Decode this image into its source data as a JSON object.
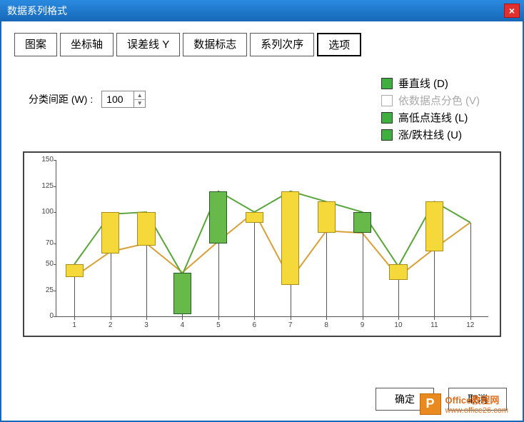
{
  "window": {
    "title": "数据系列格式",
    "close_label": "×"
  },
  "tabs": [
    {
      "label": "图案"
    },
    {
      "label": "坐标轴"
    },
    {
      "label": "误差线 Y"
    },
    {
      "label": "数据标志"
    },
    {
      "label": "系列次序"
    },
    {
      "label": "选项",
      "active": true
    }
  ],
  "gap": {
    "label": "分类间距 (W) :",
    "value": "100"
  },
  "legend_options": [
    {
      "label": "垂直线 (D)",
      "swatch": "green",
      "enabled": true
    },
    {
      "label": "依数据点分色 (V)",
      "swatch": "empty",
      "enabled": false
    },
    {
      "label": "高低点连线 (L)",
      "swatch": "green",
      "enabled": true
    },
    {
      "label": "涨/跌柱线 (U)",
      "swatch": "green",
      "enabled": true
    }
  ],
  "buttons": {
    "ok": "确定",
    "cancel": "取消"
  },
  "watermark": {
    "badge": "P",
    "line1": "Office教程网",
    "line2": "www.office26.com"
  },
  "chart_data": {
    "type": "candlestick",
    "xlabel": "",
    "ylabel": "",
    "ylim": [
      0,
      150
    ],
    "yticks": [
      0,
      25,
      50,
      70,
      100,
      125,
      150
    ],
    "categories": [
      "1",
      "2",
      "3",
      "4",
      "5",
      "6",
      "7",
      "8",
      "9",
      "10",
      "11",
      "12"
    ],
    "series_high": [
      50,
      100,
      100,
      42,
      120,
      100,
      120,
      110,
      100,
      50,
      110,
      90
    ],
    "series_low": [
      38,
      60,
      68,
      2,
      70,
      90,
      30,
      80,
      80,
      35,
      62,
      90
    ],
    "series_line_a": [
      50,
      98,
      100,
      40,
      120,
      100,
      120,
      110,
      100,
      48,
      110,
      90
    ],
    "series_line_b": [
      38,
      62,
      70,
      42,
      72,
      100,
      35,
      82,
      80,
      38,
      65,
      90
    ],
    "bar_color": [
      "yellow",
      "yellow",
      "yellow",
      "green",
      "green",
      "yellow",
      "yellow",
      "yellow",
      "green",
      "yellow",
      "yellow",
      "none"
    ],
    "colors": {
      "up": "#67b94a",
      "down": "#f5d93b",
      "line_a": "#5aa53a",
      "line_b": "#d8a038"
    }
  }
}
